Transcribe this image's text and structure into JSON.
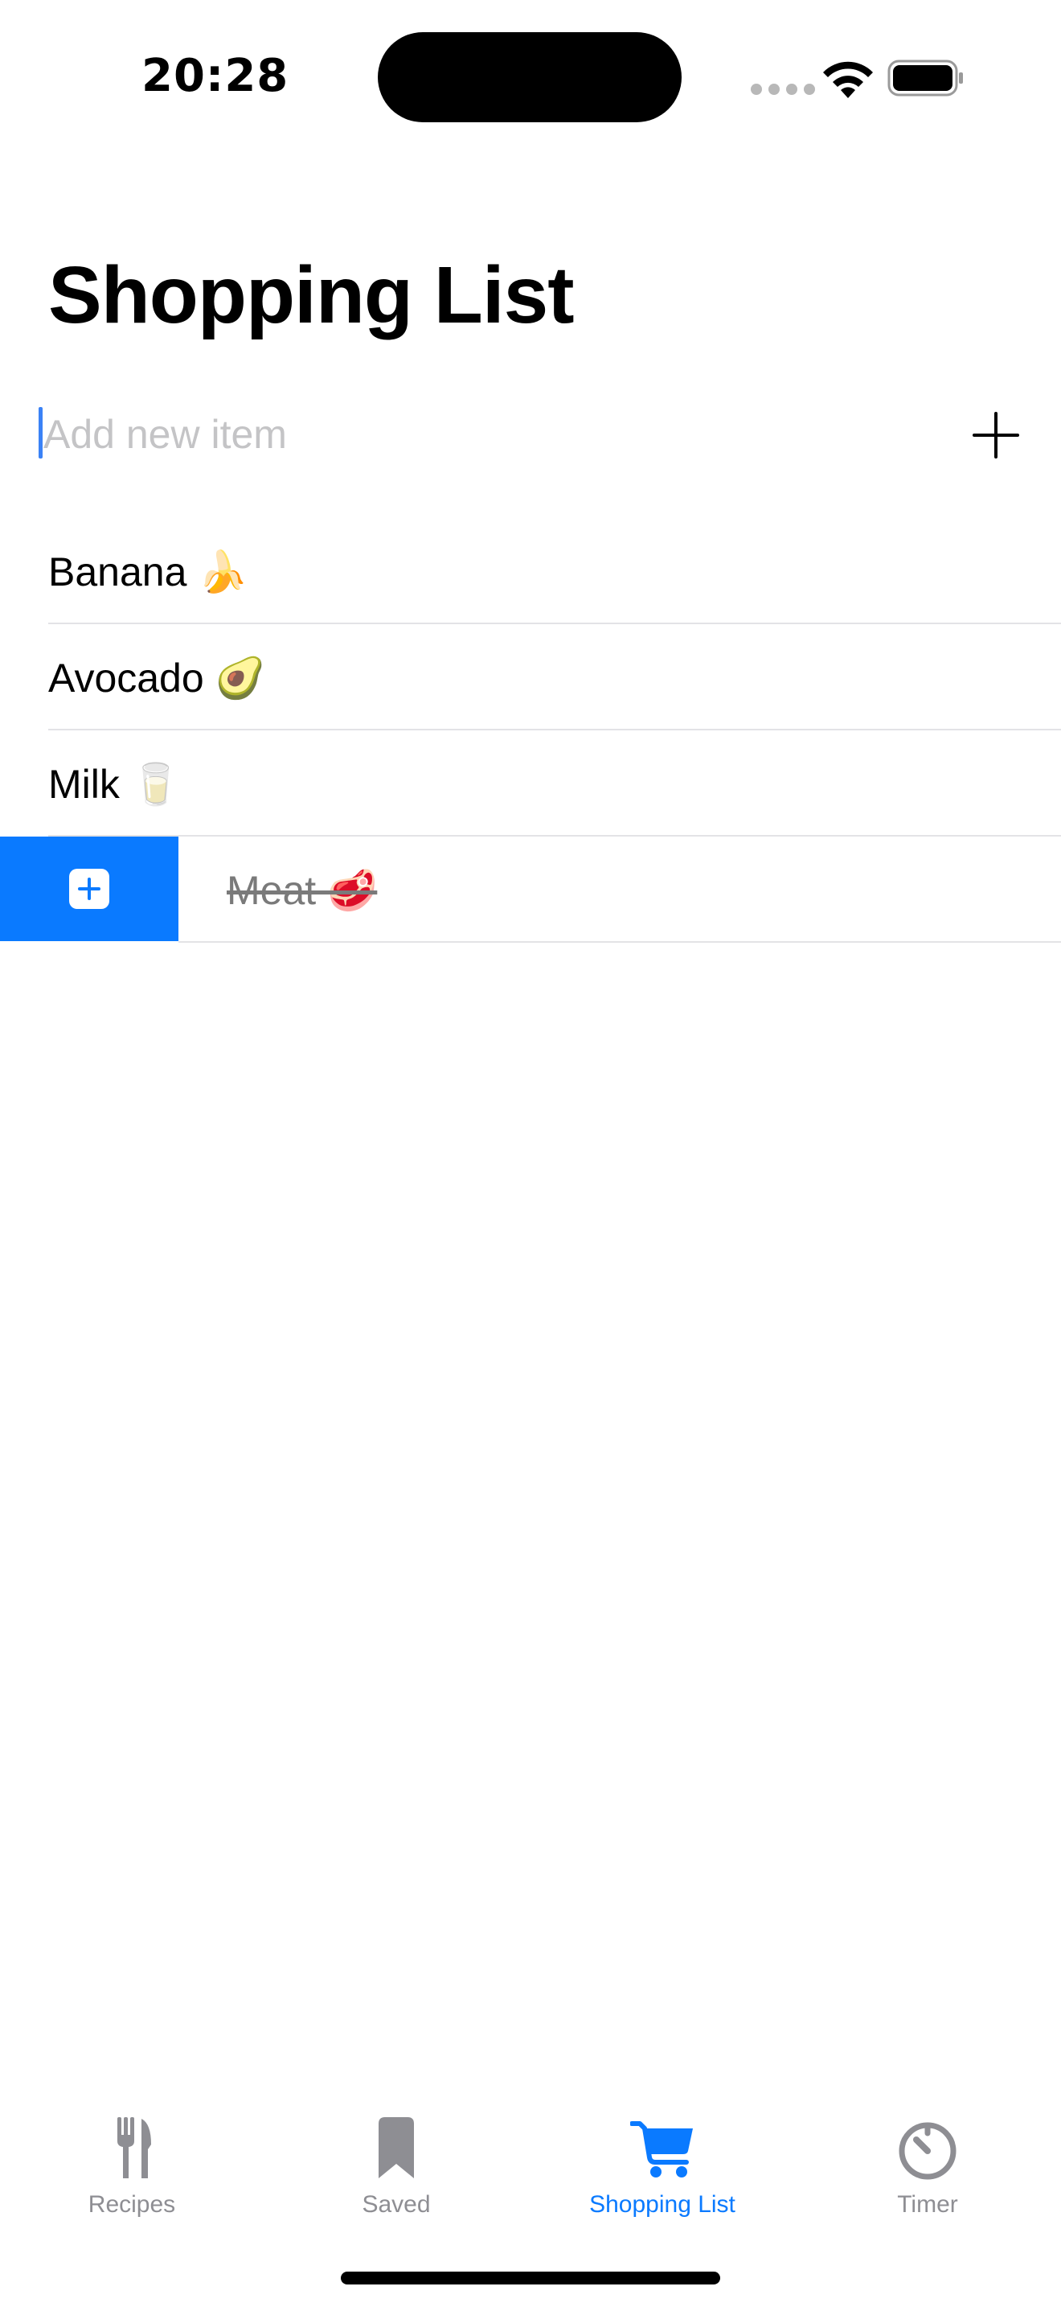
{
  "status_bar": {
    "time": "20:28"
  },
  "page": {
    "title": "Shopping List"
  },
  "add_item": {
    "placeholder": "Add new item"
  },
  "list": {
    "items": [
      {
        "label": "Banana 🍌",
        "checked": false
      },
      {
        "label": "Avocado 🥑",
        "checked": false
      },
      {
        "label": "Milk 🥛",
        "checked": false
      },
      {
        "label": "Meat 🥩",
        "checked": true
      }
    ]
  },
  "tab_bar": {
    "tabs": [
      {
        "label": "Recipes",
        "icon": "fork-knife-icon",
        "active": false
      },
      {
        "label": "Saved",
        "icon": "bookmark-icon",
        "active": false
      },
      {
        "label": "Shopping List",
        "icon": "cart-icon",
        "active": true
      },
      {
        "label": "Timer",
        "icon": "timer-icon",
        "active": false
      }
    ]
  },
  "colors": {
    "accent": "#0a7aff",
    "inactive": "#8e8e93",
    "separator": "#e3e3e6"
  }
}
